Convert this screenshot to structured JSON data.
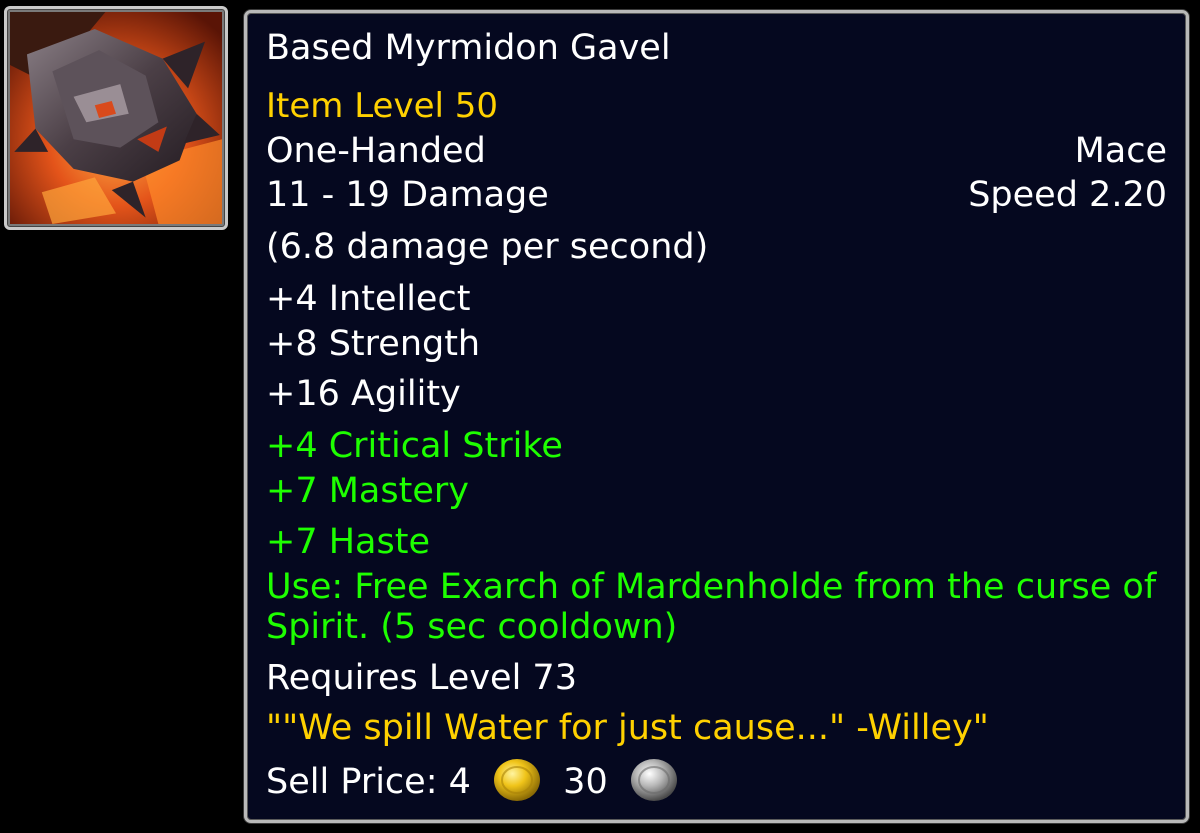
{
  "item": {
    "name": "Based Myrmidon Gavel",
    "item_level": "Item Level 50",
    "hand": "One-Handed",
    "weapon_type": "Mace",
    "damage": "11 - 19 Damage",
    "speed": "Speed 2.20",
    "dps": "(6.8 damage per second)",
    "stats": [
      "+4 Intellect",
      "+8 Strength",
      "+16 Agility"
    ],
    "secondary_stats": [
      "+4 Critical Strike",
      "+7 Mastery",
      "+7 Haste"
    ],
    "use_effect": "Use: Free Exarch of Mardenholde from the curse of Spirit. (5 sec cooldown)",
    "requires": "Requires Level 73",
    "flavor_text": "\"\"We spill Water for just cause...\" -Willey\"",
    "sell_price_label": "Sell Price: 4",
    "silver_amount": "30"
  },
  "icons": {
    "item_icon": "mace-icon",
    "gold_coin": "gold-coin-icon",
    "silver_coin": "silver-coin-icon"
  },
  "colors": {
    "tooltip_bg": "#05081f",
    "border": "#b9b9b9",
    "item_level": "#ffd100",
    "stat_bonus": "#1eff00",
    "flavor": "#ffd100",
    "text": "#ffffff"
  }
}
